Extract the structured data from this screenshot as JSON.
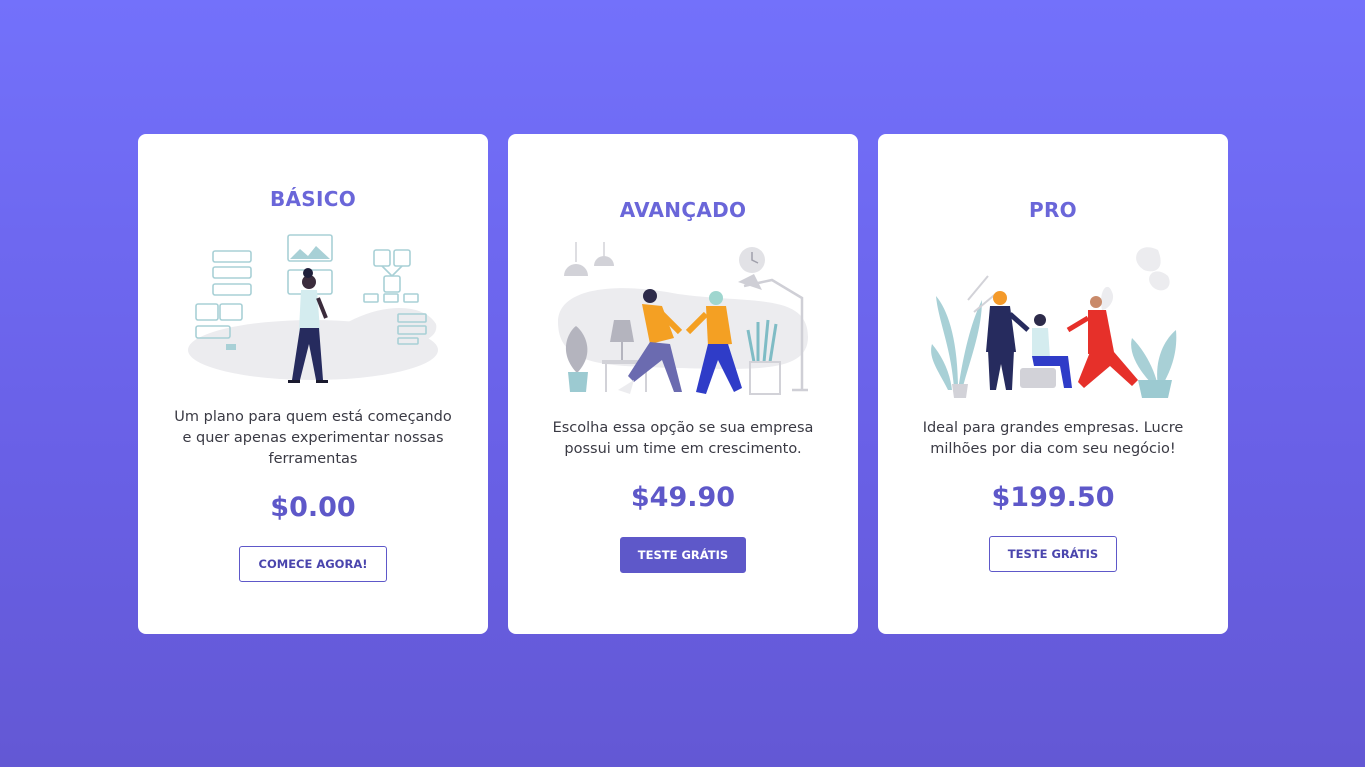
{
  "plans": [
    {
      "title": "BÁSICO",
      "description": "Um plano para quem está começando e quer apenas experimentar nossas ferramentas",
      "price": "$0.00",
      "button_label": "COMECE AGORA!"
    },
    {
      "title": "AVANÇADO",
      "description": "Escolha essa opção se sua empresa possui um time em crescimento.",
      "price": "$49.90",
      "button_label": "TESTE GRÁTIS"
    },
    {
      "title": "PRO",
      "description": "Ideal para grandes empresas. Lucre milhões por dia com seu negócio!",
      "price": "$199.50",
      "button_label": "TESTE GRÁTIS"
    }
  ],
  "colors": {
    "background_top": "#7371fb",
    "background_bottom": "#6358d4",
    "accent": "#5e58c9",
    "title": "#6a66d9",
    "card": "#ffffff"
  },
  "icons": [
    "person-with-wireframes-illustration",
    "two-people-running-illustration",
    "team-meeting-illustration"
  ]
}
